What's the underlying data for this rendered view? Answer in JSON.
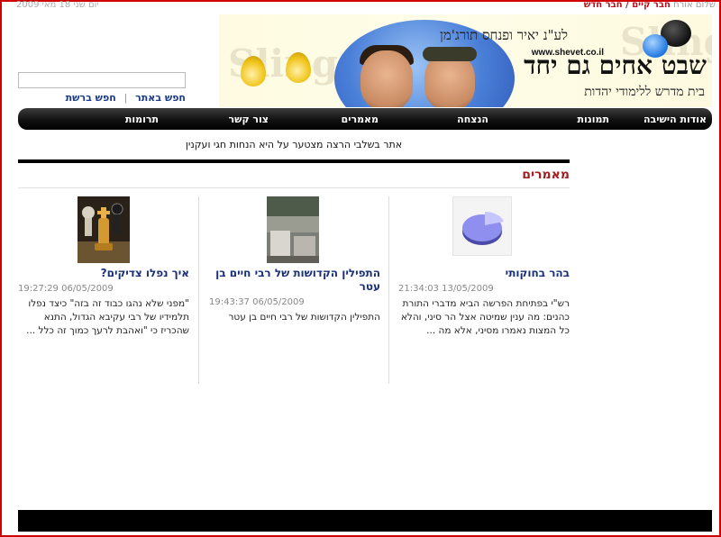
{
  "topbar": {
    "greeting": "שלום אורח",
    "existing_member": "חבר קיים",
    "separator": "/",
    "new_member": "חבר חדש",
    "date": "יום שני 18 מאי 2009"
  },
  "banner": {
    "dedication": "לע\"נ יאיר ופנחס תורג'מן",
    "url": "www.shevet.co.il",
    "title": "שבט אחים גם יחד",
    "subtitle": "בית מדרש ללימודי יהדות",
    "watermark": "Sling"
  },
  "search": {
    "value": "",
    "search_site": "חפש באתר",
    "search_web": "חפש ברשת",
    "divider": "|"
  },
  "nav": {
    "items": [
      {
        "label": "אודות הישיבה"
      },
      {
        "label": "תמונות"
      },
      {
        "label": "הנצחה"
      },
      {
        "label": "מאמרים"
      },
      {
        "label": "צור קשר"
      },
      {
        "label": "תרומות"
      }
    ]
  },
  "ticker": "אתר בשלבי הרצה מצטער על היא הנחות חגי ועקנין",
  "section": {
    "title": "מאמרים"
  },
  "articles": [
    {
      "title": "בהר בחוקותי",
      "date": "21:34:03 13/05/2009",
      "summary": "רש\"י בפתיחת הפרשה הביא מדברי התורת כהנים: מה ענין שמיטה אצל הר סיני, והלא כל המצות נאמרו מסיני, אלא מה ...",
      "icon": "pie-chart-icon"
    },
    {
      "title": "התפילין הקדושות של רבי חיים בן עטר",
      "date": "19:43:37 06/05/2009",
      "summary": "התפילין הקדושות של רבי חיים בן עטר",
      "icon": "photo-thumbnail"
    },
    {
      "title": "איך נפלו צדיקים?",
      "date": "19:27:29 06/05/2009",
      "summary": "\"מפני שלא נהגו כבוד זה בזה\" כיצד נפלו תלמידיו של רבי עקיבא הגדול, התנא שהכריז כי \"ואהבת לרעך כמוך זה כלל ...",
      "icon": "chess-king-icon"
    }
  ],
  "colors": {
    "accent_red": "#b5121b",
    "link_blue": "#1a3a8a",
    "nav_black": "#000000"
  }
}
